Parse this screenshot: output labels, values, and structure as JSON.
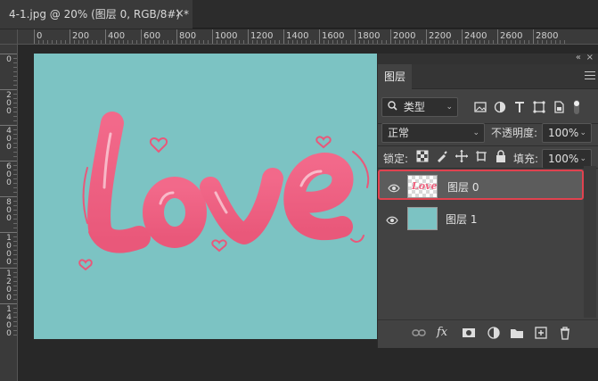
{
  "document_tab": {
    "title": "4-1.jpg @ 20% (图层 0, RGB/8#) *",
    "close": "×"
  },
  "ruler": {
    "top_labels": [
      "0",
      "200",
      "400",
      "600",
      "800",
      "1000",
      "1200",
      "1400",
      "1600",
      "1800",
      "2000",
      "2200",
      "2400",
      "2600",
      "2800"
    ],
    "left_labels": [
      "0",
      "2\n0\n0",
      "4\n0\n0",
      "6\n0\n0",
      "8\n0\n0",
      "1\n0\n0\n0",
      "1\n2\n0\n0",
      "1\n4\n0\n0"
    ]
  },
  "canvas": {
    "background": "#7cc3c3",
    "text": "Love",
    "text_color": "#f0617f"
  },
  "layers_panel": {
    "tab_label": "图层",
    "collapse_icon": "«",
    "close_icon": "×",
    "filter": {
      "kind_label": "类型",
      "icons": [
        "pixel-filter-icon",
        "adjustment-filter-icon",
        "type-filter-icon",
        "shape-filter-icon",
        "smart-object-filter-icon",
        "filter-toggle-icon"
      ]
    },
    "blend_mode": "正常",
    "opacity_label": "不透明度:",
    "opacity_value": "100%",
    "lock_label": "锁定:",
    "fill_label": "填充:",
    "fill_value": "100%",
    "layers": [
      {
        "name": "图层 0",
        "selected": true,
        "visible": true,
        "thumb": "Love"
      },
      {
        "name": "图层 1",
        "selected": false,
        "visible": true,
        "thumb": ""
      }
    ],
    "accent_color": "#e0424f",
    "footer_icons": [
      "link-layers-icon",
      "fx-icon",
      "add-mask-icon",
      "adjustment-layer-icon",
      "group-folder-icon",
      "new-layer-icon",
      "trash-icon"
    ],
    "fx_label": "fx"
  }
}
